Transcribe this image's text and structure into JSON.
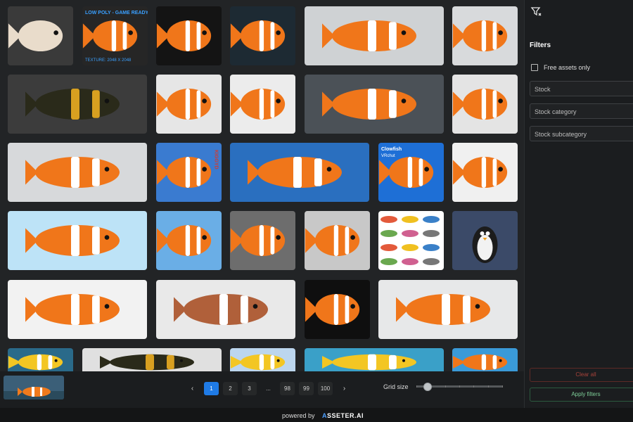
{
  "sidebar": {
    "filters_title": "Filters",
    "free_assets_label": "Free assets only",
    "fields": [
      "Stock",
      "Stock category",
      "Stock subcategory"
    ],
    "clear_label": "Clear all",
    "apply_label": "Apply filters",
    "filter_icon": "filter-icon"
  },
  "tiles": [
    {
      "bg": "#3a3a3a",
      "fish": "pale",
      "text": ""
    },
    {
      "bg": "#262626",
      "fish": "orange",
      "text": "LOW POLY - GAME READY",
      "text2": "TEXTURE: 2048 X 2048"
    },
    {
      "bg": "#141414",
      "fish": "orange"
    },
    {
      "bg": "#1d2a33",
      "fish": "orange"
    },
    {
      "bg": "#cfd2d4",
      "fish": "orange"
    },
    {
      "bg": "#d8dadc",
      "fish": "orange"
    },
    {
      "bg": "#3c3c3c",
      "fish": "dark"
    },
    {
      "bg": "#e6e6e6",
      "fish": "orange"
    },
    {
      "bg": "#ececec",
      "fish": "orange"
    },
    {
      "bg": "#4b5157",
      "fish": "orange"
    },
    {
      "bg": "#e4e4e4",
      "fish": "orange"
    },
    {
      "bg": "#d7d9db",
      "fish": "orange"
    },
    {
      "bg": "#3a7bd0",
      "fish": "orange",
      "side": "KIGGYD"
    },
    {
      "bg": "#2a6fbf",
      "fish": "orange"
    },
    {
      "bg": "#1e6fd6",
      "fish": "orange",
      "text": "Clowfish",
      "text2": "VRchut"
    },
    {
      "bg": "#f0f0f0",
      "fish": "orange"
    },
    {
      "bg": "#bde3f7",
      "fish": "orange"
    },
    {
      "bg": "#6aaee6",
      "fish": "orange"
    },
    {
      "bg": "#6d6d6d",
      "fish": "orange"
    },
    {
      "bg": "#c8c8c8",
      "fish": "orange"
    },
    {
      "bg": "#ffffff",
      "fish": "multi"
    },
    {
      "bg": "#3b4a68",
      "fish": "penguin"
    },
    {
      "bg": "#f2f2f2",
      "fish": "orange"
    },
    {
      "bg": "#e9e9e9",
      "fish": "brown"
    },
    {
      "bg": "#0f0f0f",
      "fish": "orange"
    },
    {
      "bg": "#e7e8e9",
      "fish": "orange"
    },
    {
      "bg": "#2a6a8a",
      "fish": "yellow"
    },
    {
      "bg": "#e0e0e0",
      "fish": "dark"
    },
    {
      "bg": "#bcd6ee",
      "fish": "yellow"
    },
    {
      "bg": "#3aa0c8",
      "fish": "yellow"
    },
    {
      "bg": "#3a9ad8",
      "fish": "orange"
    }
  ],
  "pagination": {
    "prev": "‹",
    "pages": [
      "1",
      "2",
      "3",
      "...",
      "98",
      "99",
      "100"
    ],
    "active": "1",
    "next": "›"
  },
  "grid_size_label": "Grid size",
  "grid_size_value": 0.1,
  "footer": {
    "powered_by": "powered by",
    "brand": "ASSETER.AI"
  }
}
